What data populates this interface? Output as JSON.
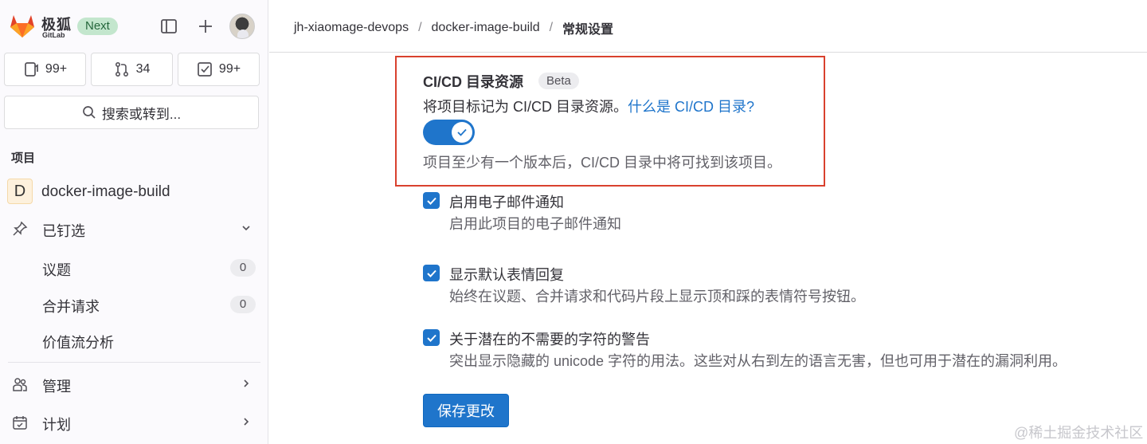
{
  "brand": {
    "name_cn": "极狐",
    "name_en": "GitLab",
    "next_badge": "Next"
  },
  "counters": [
    {
      "icon": "issues-icon",
      "value": "99+"
    },
    {
      "icon": "merge-request-icon",
      "value": "34"
    },
    {
      "icon": "todo-icon",
      "value": "99+"
    }
  ],
  "search": {
    "label": "搜索或转到..."
  },
  "sidebar": {
    "section_label": "项目",
    "project": {
      "avatar_letter": "D",
      "name": "docker-image-build"
    },
    "pinned": {
      "label": "已钉选"
    },
    "pinned_items": [
      {
        "label": "议题",
        "count": "0"
      },
      {
        "label": "合并请求",
        "count": "0"
      },
      {
        "label": "价值流分析"
      }
    ],
    "manage": {
      "label": "管理"
    },
    "plan": {
      "label": "计划"
    }
  },
  "breadcrumb": {
    "group": "jh-xiaomage-devops",
    "project": "docker-image-build",
    "current": "常规设置",
    "separator": "/"
  },
  "cicd": {
    "title": "CI/CD 目录资源",
    "badge": "Beta",
    "description": "将项目标记为 CI/CD 目录资源。",
    "link": "什么是 CI/CD 目录?",
    "toggle_on": true,
    "help": "项目至少有一个版本后，CI/CD 目录中将可找到该项目。"
  },
  "options": [
    {
      "title": "启用电子邮件通知",
      "help": "启用此项目的电子邮件通知",
      "checked": true
    },
    {
      "title": "显示默认表情回复",
      "help": "始终在议题、合并请求和代码片段上显示顶和踩的表情符号按钮。",
      "checked": true
    },
    {
      "title": "关于潜在的不需要的字符的警告",
      "help": "突出显示隐藏的 unicode 字符的用法。这些对从右到左的语言无害，但也可用于潜在的漏洞利用。",
      "checked": true
    }
  ],
  "save_button": "保存更改",
  "watermark": "@稀土掘金技术社区",
  "colors": {
    "accent": "#1f75cb",
    "highlight_box": "#d9412e",
    "next_badge_bg": "#c3e6cd"
  }
}
